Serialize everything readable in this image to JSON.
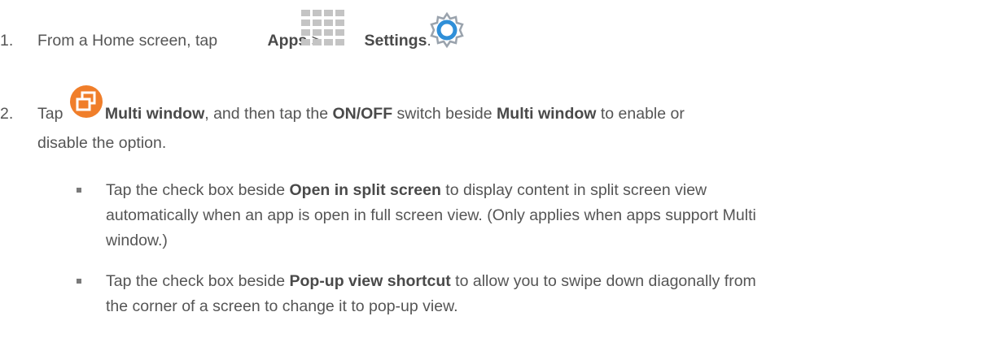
{
  "steps": [
    {
      "number": "1.",
      "intro": "From a Home screen, tap ",
      "apps_label": "Apps",
      "sep": " > ",
      "settings_label": "Settings",
      "end": "."
    },
    {
      "number": "2.",
      "tap": "Tap ",
      "multi_window_label": "Multi window",
      "mid1": ", and then tap the ",
      "onoff_label": "ON/OFF",
      "mid2": " switch beside ",
      "multi_window_label2": "Multi window",
      "mid3": " to enable or",
      "line2": "disable the option."
    }
  ],
  "bullets": [
    {
      "pre": "Tap the check box beside ",
      "bold": "Open in split screen",
      "post": " to display content in split screen view",
      "line2": "automatically when an app is open in full screen view. (Only applies when apps support Multi",
      "line3": "window.)"
    },
    {
      "pre": "Tap the check box beside ",
      "bold": "Pop-up view shortcut",
      "post": " to allow you to swipe down diagonally from",
      "line2": "the corner of a screen to change it to pop-up view."
    }
  ],
  "icons": {
    "apps": "apps-grid-icon",
    "settings": "settings-gear-icon",
    "multi_window": "multi-window-icon",
    "accent_orange": "#F07E2A",
    "settings_blue": "#2F8FD8"
  }
}
